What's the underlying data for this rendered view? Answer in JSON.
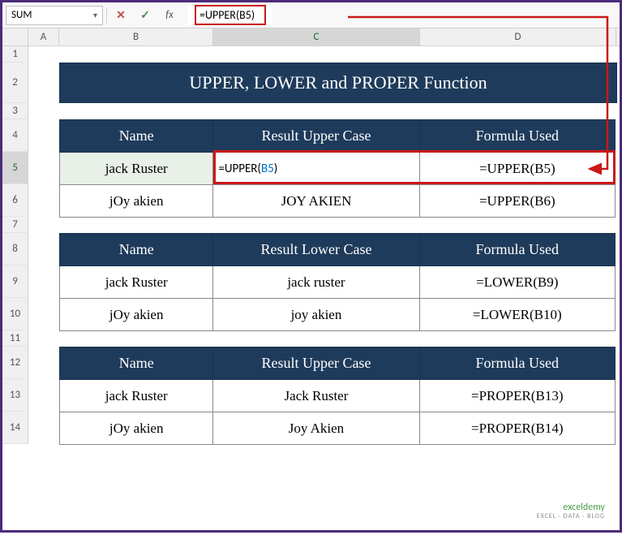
{
  "name_box": "SUM",
  "formula_bar": {
    "cancel_glyph": "✕",
    "confirm_glyph": "✓",
    "fx_label": "fx",
    "formula_prefix": "=UPPER(",
    "formula_ref": "B5",
    "formula_suffix": ")"
  },
  "columns": [
    "A",
    "B",
    "C",
    "D"
  ],
  "rows": [
    "1",
    "2",
    "3",
    "4",
    "5",
    "6",
    "7",
    "8",
    "9",
    "10",
    "11",
    "12",
    "13",
    "14"
  ],
  "title": "UPPER, LOWER and PROPER Function",
  "table1": {
    "headers": [
      "Name",
      "Result Upper Case",
      "Formula Used"
    ],
    "rows": [
      {
        "name": "jack Ruster",
        "result_prefix": "=UPPER(",
        "result_ref": "B5",
        "result_suffix": ")",
        "formula": "=UPPER(B5)"
      },
      {
        "name": "jOy akien",
        "result": "JOY AKIEN",
        "formula": "=UPPER(B6)"
      }
    ]
  },
  "table2": {
    "headers": [
      "Name",
      "Result Lower Case",
      "Formula Used"
    ],
    "rows": [
      {
        "name": "jack Ruster",
        "result": "jack ruster",
        "formula": "=LOWER(B9)"
      },
      {
        "name": "jOy akien",
        "result": "joy akien",
        "formula": "=LOWER(B10)"
      }
    ]
  },
  "table3": {
    "headers": [
      "Name",
      "Result Upper Case",
      "Formula Used"
    ],
    "rows": [
      {
        "name": "jack Ruster",
        "result": "Jack Ruster",
        "formula": "=PROPER(B13)"
      },
      {
        "name": "jOy akien",
        "result": "Joy Akien",
        "formula": "=PROPER(B14)"
      }
    ]
  },
  "watermark": {
    "main": "exceldemy",
    "sub": "EXCEL · DATA · BLOG"
  }
}
